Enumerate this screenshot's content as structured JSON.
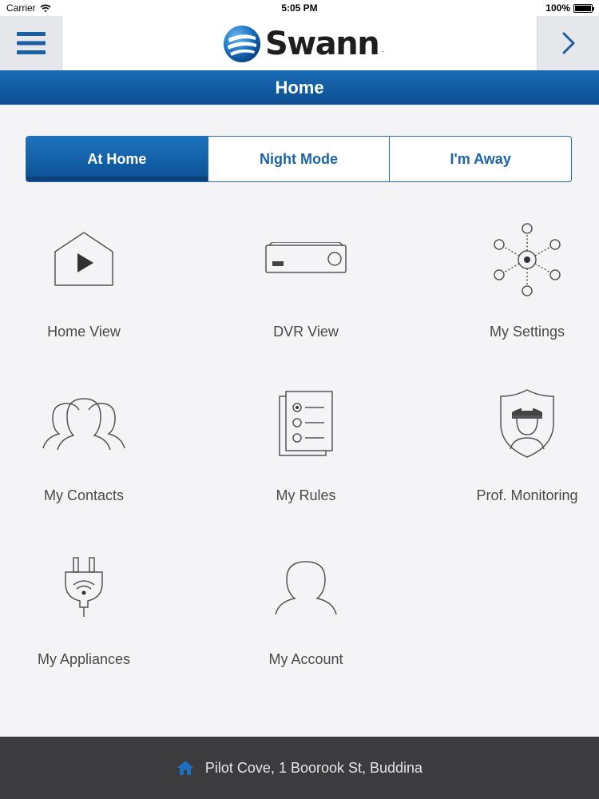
{
  "status_bar": {
    "carrier": "Carrier",
    "time": "5:05 PM",
    "battery": "100%",
    "battery_level": 1.0
  },
  "header": {
    "menu_icon": "hamburger-menu-icon",
    "logo_text": "Swann",
    "logo_mark": ".",
    "next_icon": "chevron-right-icon"
  },
  "title_bar": {
    "title": "Home"
  },
  "modes": [
    {
      "label": "At Home",
      "active": true
    },
    {
      "label": "Night Mode",
      "active": false
    },
    {
      "label": "I'm Away",
      "active": false
    }
  ],
  "grid": [
    {
      "label": "Home View",
      "icon": "home-play-icon"
    },
    {
      "label": "DVR View",
      "icon": "dvr-icon"
    },
    {
      "label": "My Settings",
      "icon": "settings-network-icon"
    },
    {
      "label": "My Contacts",
      "icon": "contacts-icon"
    },
    {
      "label": "My Rules",
      "icon": "rules-checklist-icon"
    },
    {
      "label": "Prof. Monitoring",
      "icon": "security-guard-shield-icon"
    },
    {
      "label": "My Appliances",
      "icon": "smart-plug-icon"
    },
    {
      "label": "My Account",
      "icon": "account-person-icon"
    }
  ],
  "footer": {
    "address": "Pilot Cove, 1 Boorook St, Buddina",
    "icon": "home-icon"
  },
  "colors": {
    "accent_blue": "#1b63a8",
    "title_bar_blue": "#0c4f93",
    "footer_bg": "#3c3c3e",
    "icon_stroke": "#555555"
  }
}
